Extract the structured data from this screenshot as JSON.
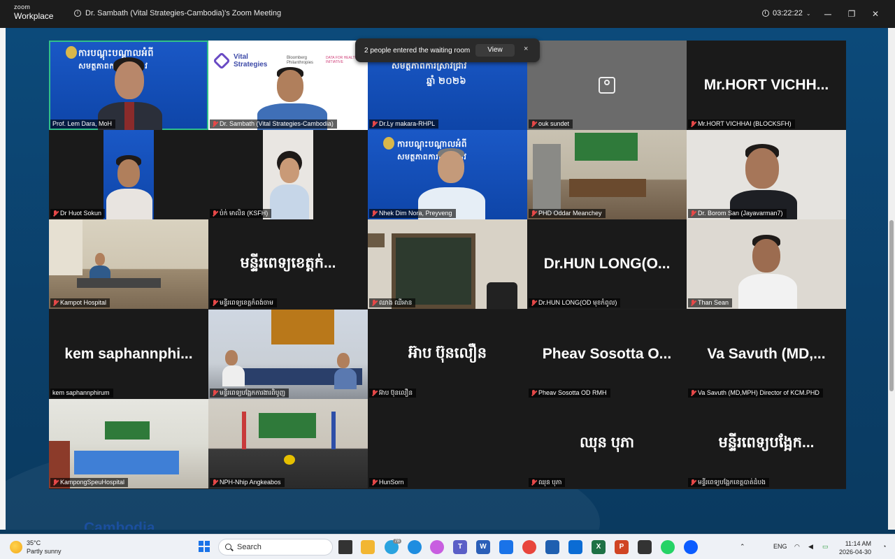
{
  "titlebar": {
    "app_line1": "zoom",
    "app_line2": "Workplace",
    "meeting_title": "Dr. Sambath (Vital Strategies-Cambodia)'s Zoom Meeting",
    "timer": "03:22:22",
    "minimize": "─",
    "maximize": "❐",
    "close": "✕"
  },
  "notification": {
    "text": "2 people entered the waiting room",
    "view_label": "View",
    "close_label": "×"
  },
  "slides": {
    "khmer_line1": "ការបណ្តុះបណ្តាលអំពី",
    "khmer_line2": "សមត្ថភាពការស្រាវជ្រាវ",
    "year_line": "ឆ្នាំ ២០២៦",
    "vital_logo": "Vital Strategies",
    "bloomberg_logo": "Bloomberg Philanthropies",
    "d4h_logo": "DATA FOR HEALTH INITIATIVE"
  },
  "participants": [
    {
      "label": "Prof. Lem Dara, MoH",
      "display": ""
    },
    {
      "label": "Dr. Sambath (Vital Strategies-Cambodia)",
      "display": ""
    },
    {
      "label": "Dr.Ly makara-RHPL",
      "display": ""
    },
    {
      "label": "ouk sundet",
      "display": ""
    },
    {
      "label": "Mr.HORT VICHHAI (BLOCKSFH)",
      "display": "Mr.HORT VICHH..."
    },
    {
      "label": "Dr Huot Sokun",
      "display": ""
    },
    {
      "label": "ប៉ក់ មាលិន (KSFH)",
      "display": ""
    },
    {
      "label": "Nhek Dim Nora, Preyveng",
      "display": ""
    },
    {
      "label": "PHD Oddar Meanchey",
      "display": ""
    },
    {
      "label": "Dr. Borom San (Jayavarman7)",
      "display": ""
    },
    {
      "label": "Kampot Hospital",
      "display": ""
    },
    {
      "label": "មន្ទីរពេទ្យខេត្តកំពង់ចាម",
      "display": "មន្ទីរពេទ្យខេត្តក់..."
    },
    {
      "label": "ឈាង ឈីអាន",
      "display": ""
    },
    {
      "label": "Dr.HUN LONG(OD មុខកំពូល)",
      "display": "Dr.HUN LONG(O..."
    },
    {
      "label": "Than Sean",
      "display": ""
    },
    {
      "label": "kem saphannphirum",
      "display": "kem saphannphi..."
    },
    {
      "label": "មន្ទីរពេទ្យបង្អែកការងារពិបូញ",
      "display": ""
    },
    {
      "label": "អ៊ាប ប៊ុនលឿន",
      "display": "អ៊ាប ប៊ុនលឿន"
    },
    {
      "label": "Pheav Sosotta OD RMH",
      "display": "Pheav Sosotta O..."
    },
    {
      "label": "Va Savuth (MD,MPH) Director of KCM.PHD",
      "display": "Va Savuth (MD,..."
    },
    {
      "label": "KampongSpeuHospital",
      "display": ""
    },
    {
      "label": "NPH-Nhip Angkeabos",
      "display": ""
    },
    {
      "label": "HunSorn",
      "display": ""
    },
    {
      "label": "ឈុន បុភា",
      "display": "ឈុន បុភា"
    },
    {
      "label": "មន្ទីរពេទ្យបង្អែកខេត្តបាត់ដំបង",
      "display": "មន្ទីរពេទ្យបង្អែក..."
    }
  ],
  "background_text": "Cambodia",
  "taskbar": {
    "temperature": "35°C",
    "weather": "Partly sunny",
    "search_placeholder": "Search",
    "language": "ENG",
    "time": "11:14 AM",
    "date": "2026-04-30",
    "badge_count": "78"
  },
  "colors": {
    "active_speaker_border": "#30c08a",
    "mute_red": "#e64848",
    "slide_blue": "#1a58c6"
  }
}
